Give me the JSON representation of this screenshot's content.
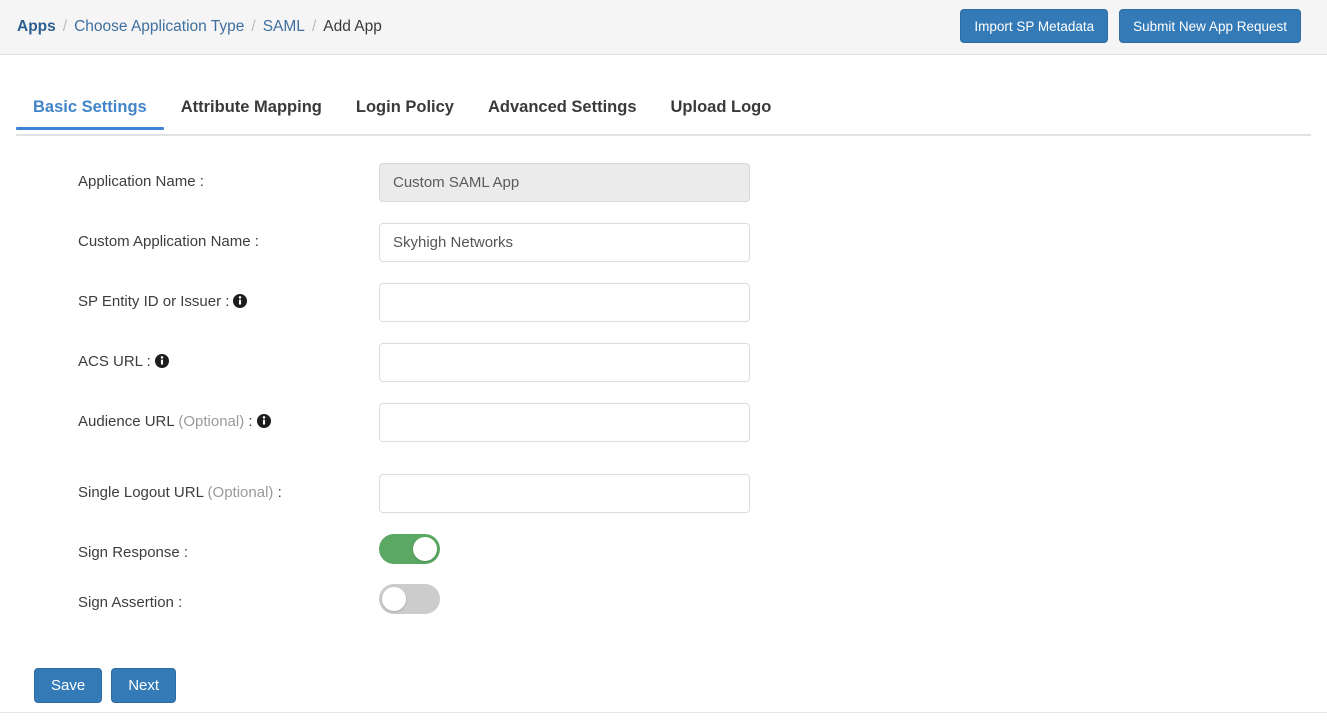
{
  "header": {
    "breadcrumb": [
      {
        "label": "Apps",
        "type": "link",
        "strong": true
      },
      {
        "label": "Choose Application Type",
        "type": "link",
        "strong": false
      },
      {
        "label": "SAML",
        "type": "link",
        "strong": false
      },
      {
        "label": "Add App",
        "type": "current",
        "strong": false
      }
    ],
    "separator": "/",
    "actions": [
      {
        "label": "Import SP Metadata",
        "name": "import-sp-metadata-button"
      },
      {
        "label": "Submit New App Request",
        "name": "submit-new-app-request-button"
      }
    ]
  },
  "tabs": [
    {
      "label": "Basic Settings",
      "active": true
    },
    {
      "label": "Attribute Mapping",
      "active": false
    },
    {
      "label": "Login Policy",
      "active": false
    },
    {
      "label": "Advanced Settings",
      "active": false
    },
    {
      "label": "Upload Logo",
      "active": false
    }
  ],
  "form": {
    "fields": [
      {
        "label": "Application Name",
        "optional": "",
        "colon": ":",
        "has_info_icon": false,
        "info_icon": "",
        "control": "text",
        "value": "Custom SAML App",
        "placeholder": "",
        "disabled": true
      },
      {
        "label": "Custom Application Name",
        "optional": "",
        "colon": ":",
        "has_info_icon": false,
        "info_icon": "",
        "control": "text",
        "value": "Skyhigh Networks",
        "placeholder": "",
        "disabled": false
      },
      {
        "label": "SP Entity ID or Issuer",
        "optional": "",
        "colon": ":",
        "has_info_icon": true,
        "info_icon": "info-icon",
        "control": "text",
        "value": "",
        "placeholder": "",
        "disabled": false
      },
      {
        "label": "ACS URL",
        "optional": "",
        "colon": ":",
        "has_info_icon": true,
        "info_icon": "info-icon",
        "control": "text",
        "value": "",
        "placeholder": "",
        "disabled": false
      },
      {
        "label": "Audience URL",
        "optional": "(Optional)",
        "colon": ":",
        "has_info_icon": true,
        "info_icon": "info-icon",
        "control": "text",
        "value": "",
        "placeholder": "",
        "disabled": false
      },
      {
        "label": "Single Logout URL",
        "optional": "(Optional)",
        "colon": ":",
        "has_info_icon": false,
        "info_icon": "",
        "control": "text",
        "value": "",
        "placeholder": "",
        "disabled": false
      },
      {
        "label": "Sign Response",
        "optional": "",
        "colon": ":",
        "has_info_icon": false,
        "info_icon": "",
        "control": "toggle",
        "value": "on",
        "placeholder": "",
        "disabled": false
      },
      {
        "label": "Sign Assertion",
        "optional": "",
        "colon": ":",
        "has_info_icon": false,
        "info_icon": "",
        "control": "toggle",
        "value": "off",
        "placeholder": "",
        "disabled": false
      }
    ]
  },
  "footer": {
    "save_label": "Save",
    "next_label": "Next"
  },
  "colors": {
    "primary_blue": "#337ab7",
    "link_blue": "#3f6f9f",
    "active_tab_blue": "#4285c8",
    "tab_underline": "#3f83d6",
    "toggle_on_green": "#5aa863",
    "toggle_off_gray": "#cccccc",
    "header_bg": "#f5f5f5",
    "disabled_field_bg": "#ebebeb"
  }
}
